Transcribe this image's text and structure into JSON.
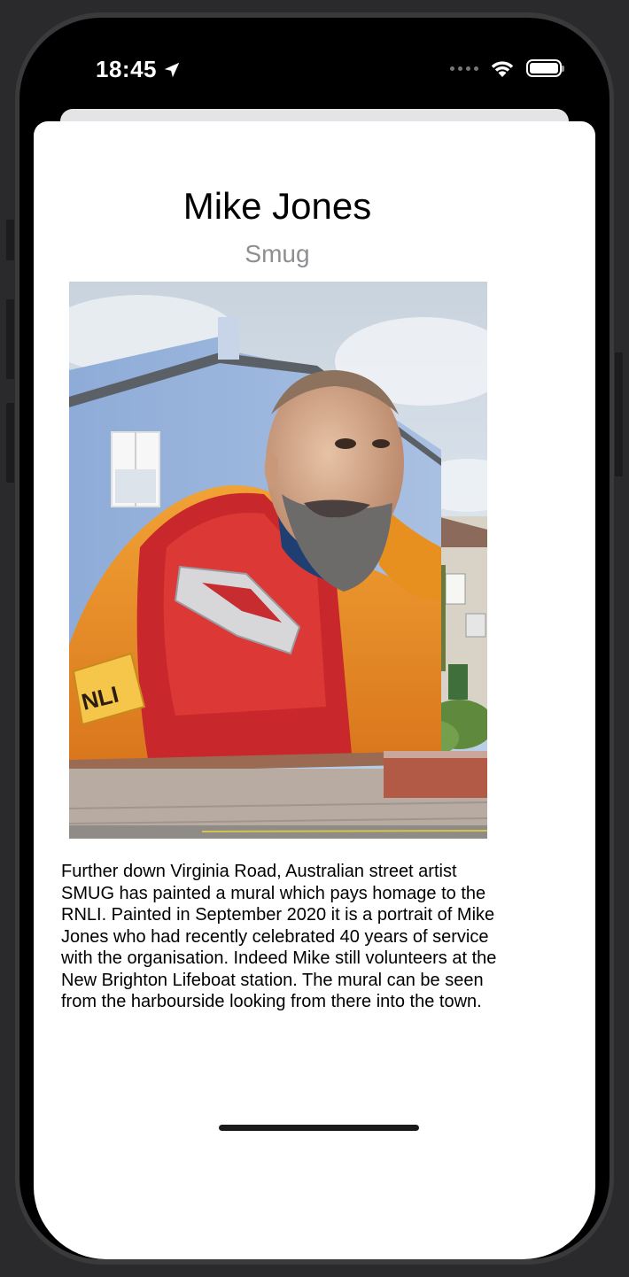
{
  "status_bar": {
    "time": "18:45",
    "location_icon": "location-arrow-icon",
    "signal_icon": "cellular-dots-icon",
    "wifi_icon": "wifi-icon",
    "battery_icon": "battery-icon"
  },
  "detail": {
    "title": "Mike Jones",
    "subtitle": "Smug",
    "image_alt": "RNLI mural on the gable end of a house",
    "description": "Further down Virginia Road, Australian street artist SMUG has painted a mural which pays homage to the RNLI. Painted in September 2020 it is a portrait of Mike Jones who had recently celebrated 40 years of service with the organisation. Indeed Mike still volunteers at the New Brighton Lifeboat station. The mural can be seen from the harbourside looking from there into the town."
  },
  "colors": {
    "background": "#000000",
    "sheet": "#ffffff",
    "subtitle": "#8e8e93"
  }
}
